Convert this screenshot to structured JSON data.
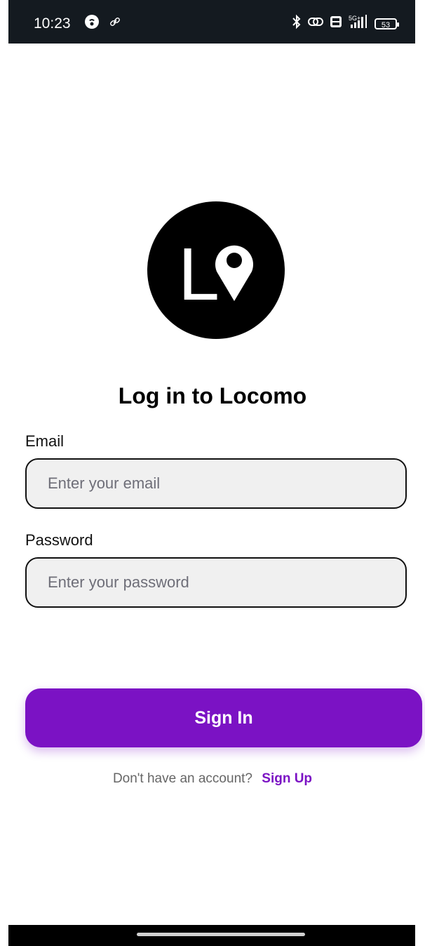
{
  "status_bar": {
    "time": "10:23",
    "network": "5G+",
    "battery_level": "53"
  },
  "logo": {
    "icon_name": "locomo-logo",
    "letter": "L"
  },
  "title": "Log in to Locomo",
  "email": {
    "label": "Email",
    "placeholder": "Enter your email",
    "value": ""
  },
  "password": {
    "label": "Password",
    "placeholder": "Enter your password",
    "value": ""
  },
  "sign_in_label": "Sign In",
  "signup": {
    "prompt": "Don't have an account?",
    "link_label": "Sign Up"
  },
  "colors": {
    "accent": "#7b12c4",
    "input_background": "#f0f0f0",
    "status_bar": "#141a20"
  }
}
